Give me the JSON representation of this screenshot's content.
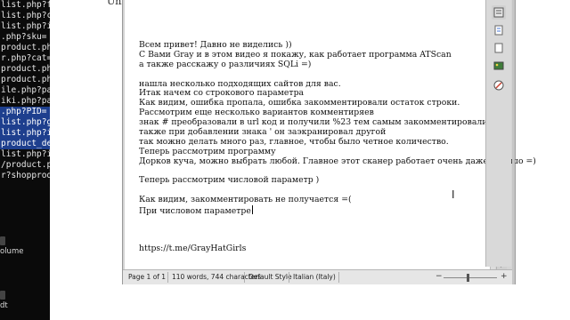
{
  "terminal": {
    "lines": [
      {
        "text": "list.php?fid",
        "hl": false
      },
      {
        "text": "list.php?cat=",
        "hl": false
      },
      {
        "text": "list.php?id=",
        "hl": false
      },
      {
        "text": ".php?sku=",
        "hl": false
      },
      {
        "text": "product.php?",
        "hl": false
      },
      {
        "text": "r.php?cat=",
        "hl": false
      },
      {
        "text": "product.php?",
        "hl": false
      },
      {
        "text": "product.php?",
        "hl": false
      },
      {
        "text": "ile.php?pag",
        "hl": false
      },
      {
        "text": "iki.php?pag",
        "hl": false
      },
      {
        "text": ".php?PID=",
        "hl": true
      },
      {
        "text": "list.php?grp",
        "hl": true
      },
      {
        "text": "list.php?id=",
        "hl": true
      },
      {
        "text": "product_deta",
        "hl": true
      },
      {
        "text": "list.php?id=",
        "hl": false
      },
      {
        "text": "/product.php",
        "hl": false
      },
      {
        "text": "r?shopprod",
        "hl": false
      }
    ]
  },
  "desktop": {
    "label1": "olume",
    "label2": "dt"
  },
  "behind_window": {
    "text": "Unknown colum"
  },
  "document": {
    "paragraphs": [
      "Всем привет! Давно не виделись ))",
      "С Вами Gray и в этом видео я покажу, как работает программа ATScan",
      "а также расскажу о различиях SQLi =)",
      "",
      "нашла несколько подходящих сайтов для вас.",
      "Итак начем со строкового параметра",
      "Как видим, ошибка пропала, ошибка закомментировали остаток строки.",
      "Рассмотрим еще несколько вариантов комментиряев",
      "знак # преобразовали в url код и получили %23 тем самым закомментировали",
      "также при добавлении знака ' он заэкранировал другой",
      "так можно делать много раз, главное, чтобы было четное количество.",
      "Теперь рассмотрим программу",
      "Дорков куча, можно выбрать любой. Главное этот сканер работает очень даже хорошо =)",
      "",
      "Теперь рассмотрим числовой параметр )",
      "",
      "Как видим, закомментировать не получается =(",
      "При числовом параметре",
      "",
      "",
      "",
      "https://t.me/GrayHatGirls"
    ]
  },
  "status_bar": {
    "page": "Page 1 of 1",
    "words": "110 words, 744 characters",
    "style": "Default Style",
    "language": "Italian (Italy)"
  },
  "sidebar": {
    "icons": [
      "properties-icon",
      "styles-icon",
      "gallery-icon",
      "navigator-icon",
      "functions-icon"
    ]
  },
  "colors": {
    "terminal_bg": "#0b0b0b",
    "terminal_highlight": "#1e3f8e",
    "page_bg": "#ffffff"
  }
}
